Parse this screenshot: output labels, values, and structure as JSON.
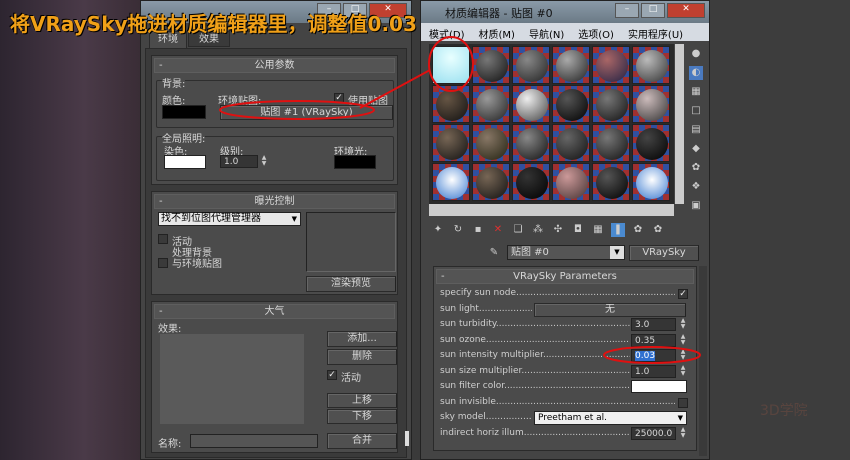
{
  "overlay_caption": "将VRaySky拖进材质编辑器里，调整值0.03",
  "env": {
    "tabs": [
      "环境",
      "效果"
    ],
    "common": {
      "title": "公用参数",
      "background": "背景:",
      "color": "颜色:",
      "env_map": "环境贴图:",
      "use_map": "使用贴图",
      "use_map_checked": true,
      "map_button": "贴图 #1 (VRaySky)",
      "global_lighting": "全局照明:",
      "tint": "染色:",
      "level": "级别:",
      "level_value": "1.0",
      "ambient": "环境光:"
    },
    "exposure": {
      "title": "曝光控制",
      "dropdown": "找不到位图代理管理器",
      "active": "活动",
      "process_bg": "处理背景",
      "process_bg2": "与环境贴图",
      "render_preview": "渲染预览"
    },
    "atmosphere": {
      "title": "大气",
      "effects": "效果:",
      "add": "添加...",
      "delete": "删除",
      "active": "活动",
      "move_up": "上移",
      "move_down": "下移",
      "name": "名称:",
      "merge": "合并"
    }
  },
  "mat_editor": {
    "title": "材质编辑器 - 贴图 #0",
    "menu": [
      "模式(D)",
      "材质(M)",
      "导航(N)",
      "选项(O)",
      "实用程序(U)"
    ],
    "map_name": "贴图 #0",
    "map_type": "VRaySky",
    "rollout_title": "VRaySky Parameters",
    "params": [
      {
        "label": "specify sun node",
        "type": "check",
        "value": true
      },
      {
        "label": "sun light",
        "type": "button",
        "value": "无"
      },
      {
        "label": "sun turbidity",
        "type": "spin",
        "value": "3.0"
      },
      {
        "label": "sun ozone",
        "type": "spin",
        "value": "0.35"
      },
      {
        "label": "sun intensity multiplier",
        "type": "spin",
        "value": "0.03"
      },
      {
        "label": "sun size multiplier",
        "type": "spin",
        "value": "1.0"
      },
      {
        "label": "sun filter color",
        "type": "color",
        "value": "#ffffff"
      },
      {
        "label": "sun invisible",
        "type": "check",
        "value": false
      },
      {
        "label": "sky model",
        "type": "select",
        "value": "Preetham et al."
      },
      {
        "label": "indirect horiz illum",
        "type": "spin",
        "value": "25000.0"
      }
    ]
  },
  "watermark": "3D学院"
}
